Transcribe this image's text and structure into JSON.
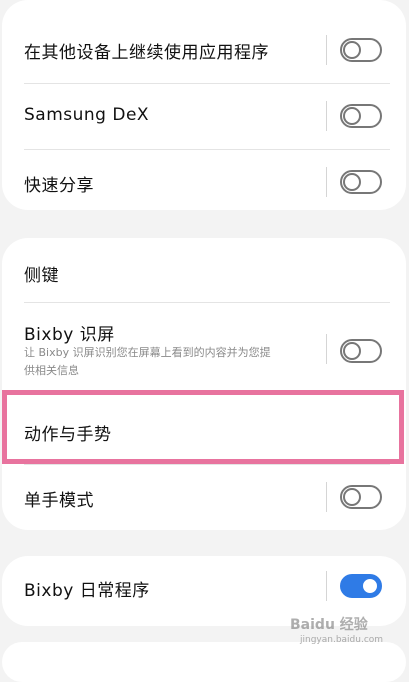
{
  "section1": {
    "items": [
      {
        "label": "在其他设备上继续使用应用程序",
        "toggle": "off"
      },
      {
        "label": "Samsung DeX",
        "toggle": "off"
      },
      {
        "label": "快速分享",
        "toggle": "off"
      }
    ]
  },
  "section2": {
    "header": "侧键",
    "bixby_screen": {
      "label": "Bixby 识屏",
      "description_line1": "让 Bixby 识屏识别您在屏幕上看到的内容并为您提",
      "description_line2": "供相关信息",
      "toggle": "off"
    },
    "motions": {
      "label": "动作与手势"
    },
    "one_hand": {
      "label": "单手模式",
      "toggle": "off"
    }
  },
  "section3": {
    "bixby_routines": {
      "label": "Bixby 日常程序",
      "toggle": "on"
    }
  },
  "watermark": {
    "text": "Baidu 经验",
    "sub": "jingyan.baidu.com"
  },
  "colors": {
    "accent": "#2f7be6",
    "highlight": "#e8739e"
  }
}
